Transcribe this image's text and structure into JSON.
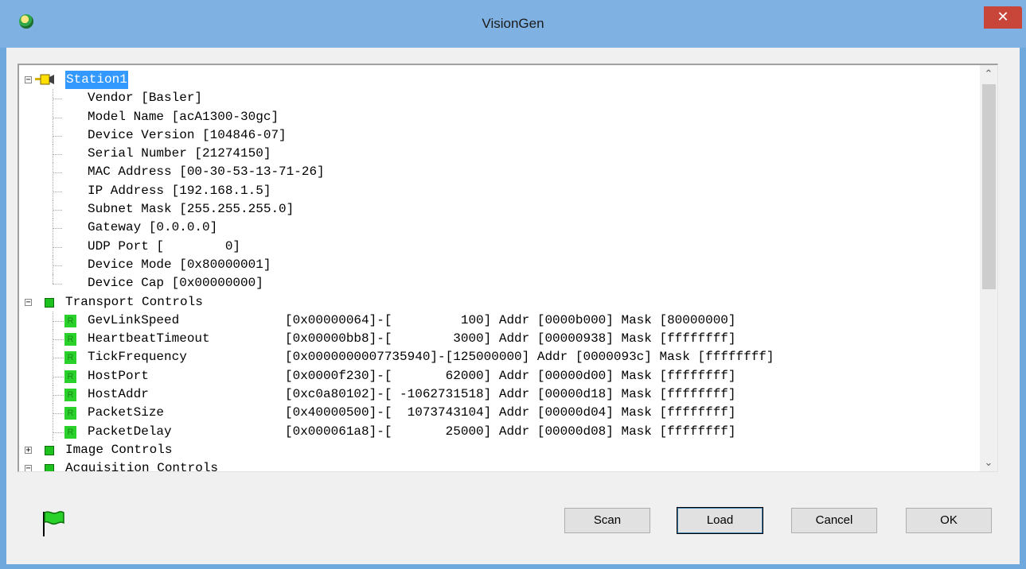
{
  "window": {
    "title": "VisionGen",
    "close_glyph": "✕"
  },
  "tree": {
    "root": {
      "label": "Station1",
      "icon": "camera-icon"
    },
    "station_items": [
      "Vendor [Basler]",
      "Model Name [acA1300-30gc]",
      "Device Version [104846-07]",
      "Serial Number [21274150]",
      "MAC Address [00-30-53-13-71-26]",
      "IP Address [192.168.1.5]",
      "Subnet Mask [255.255.255.0]",
      "Gateway [0.0.0.0]",
      "UDP Port [        0]",
      "Device Mode [0x80000001]",
      "Device Cap [0x00000000]"
    ],
    "transport": {
      "label": "Transport Controls",
      "expander": "−",
      "reg_glyph": "R",
      "registers": [
        {
          "name": "GevLinkSpeed",
          "value": "[0x00000064]-[         100] Addr [0000b000] Mask [80000000]"
        },
        {
          "name": "HeartbeatTimeout",
          "value": "[0x00000bb8]-[        3000] Addr [00000938] Mask [ffffffff]"
        },
        {
          "name": "TickFrequency",
          "value": "[0x0000000007735940]-[125000000] Addr [0000093c] Mask [ffffffff]"
        },
        {
          "name": "HostPort",
          "value": "[0x0000f230]-[       62000] Addr [00000d00] Mask [ffffffff]"
        },
        {
          "name": "HostAddr",
          "value": "[0xc0a80102]-[ -1062731518] Addr [00000d18] Mask [ffffffff]"
        },
        {
          "name": "PacketSize",
          "value": "[0x40000500]-[  1073743104] Addr [00000d04] Mask [ffffffff]"
        },
        {
          "name": "PacketDelay",
          "value": "[0x000061a8]-[       25000] Addr [00000d08] Mask [ffffffff]"
        }
      ]
    },
    "image_controls": {
      "label": "Image Controls",
      "expander": "+"
    },
    "acquisition_controls": {
      "label": "Acquisition Controls",
      "expander": "−"
    },
    "root_expander": "−",
    "scroll_up": "⌃",
    "scroll_down": "⌄"
  },
  "buttons": {
    "scan": "Scan",
    "load": "Load",
    "cancel": "Cancel",
    "ok": "OK"
  },
  "status": {
    "icon": "green-flag-icon"
  },
  "colors": {
    "selection": "#3399ff",
    "node_green": "#1ec21e",
    "titlebar": "#7fb2e3",
    "close": "#c8453a"
  }
}
